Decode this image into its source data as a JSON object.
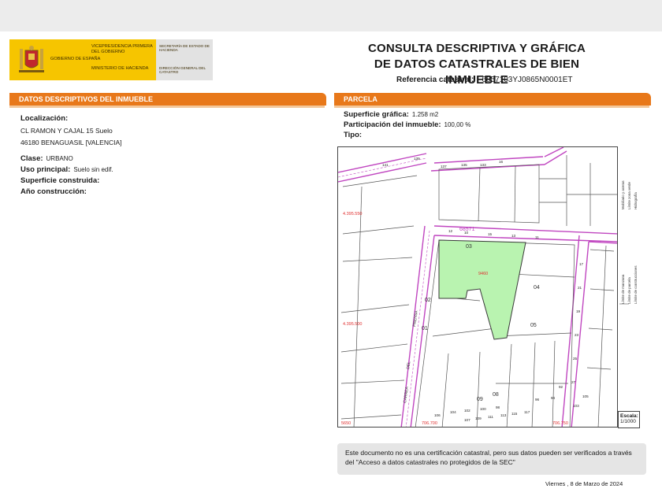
{
  "header": {
    "logo": {
      "vice": "VICEPRESIDENCIA PRIMERA DEL GOBIERNO",
      "gob": "GOBIERNO DE ESPAÑA",
      "min": "MINISTERIO DE HACIENDA",
      "sec": "SECRETARÍA DE ESTADO DE HACIENDA",
      "dir": "DIRECCIÓN GENERAL DEL CATASTRO"
    },
    "title_line1": "CONSULTA DESCRIPTIVA Y GRÁFICA",
    "title_line2": "DE DATOS CATASTRALES DE BIEN INMUEBLE",
    "ref_label": "Referencia catastral:",
    "ref_value": "6857103YJ0865N0001ET"
  },
  "left_section": {
    "title": "DATOS DESCRIPTIVOS DEL INMUEBLE",
    "localizacion_label": "Localización:",
    "address_line1": "CL RAMON Y CAJAL 15 Suelo",
    "address_line2": "46180 BENAGUASIL [VALENCIA]",
    "clase_label": "Clase:",
    "clase_value": "URBANO",
    "uso_label": "Uso principal:",
    "uso_value": "Suelo sin edif.",
    "superficie_label": "Superficie construida:",
    "anio_label": "Año construcción:"
  },
  "right_section": {
    "title": "PARCELA",
    "sup_label": "Superficie gráfica:",
    "sup_value": "1.258 m2",
    "part_label": "Participación del inmueble:",
    "part_value": "100,00 %",
    "tipo_label": "Tipo:"
  },
  "map": {
    "coord_y1": "4.395.550",
    "coord_y2": "4.395.500",
    "coord_x1": "706.700",
    "coord_x2": "706.750",
    "corner_bl": "5650",
    "block_label": "68571",
    "parcel_label": "9460",
    "street_label_1": "PRENSA",
    "street_label_2": "DEL",
    "street_label_3": "CARREA",
    "plot_labels": [
      "03",
      "04",
      "02",
      "01",
      "05",
      "09",
      "08"
    ],
    "street_numbers": [
      "141",
      "139",
      "137",
      "135",
      "133",
      "16",
      "12",
      "10",
      "15",
      "13",
      "11",
      "17",
      "21",
      "19",
      "23",
      "25",
      "27",
      "106",
      "104",
      "102",
      "100",
      "98",
      "94",
      "96",
      "92",
      "107",
      "109",
      "111",
      "113",
      "115",
      "117",
      "103",
      "105"
    ],
    "colors": {
      "parcel_fill": "#b9f3b0",
      "street_line": "#c046c0",
      "coords": "#e03030"
    }
  },
  "legend": {
    "items": [
      "Límite de manzana",
      "Límite de parcela",
      "Límite de construcciones",
      "Mobiliario y aceras",
      "Límite zona verde",
      "Hidrografía"
    ],
    "note": "Este documento no es una certificación catastral, pero sus datos pueden ser verificados a través del \"Acceso a datos catastrales no protegidos de la SEC\""
  },
  "scale": {
    "label": "Escala:",
    "value": "1/1000"
  },
  "footer": {
    "note": "Este documento no es una certificación catastral, pero sus datos pueden ser verificados a través del \"Acceso a datos catastrales no protegidos de la SEC\"",
    "date": "Viernes , 8 de Marzo de 2024"
  }
}
